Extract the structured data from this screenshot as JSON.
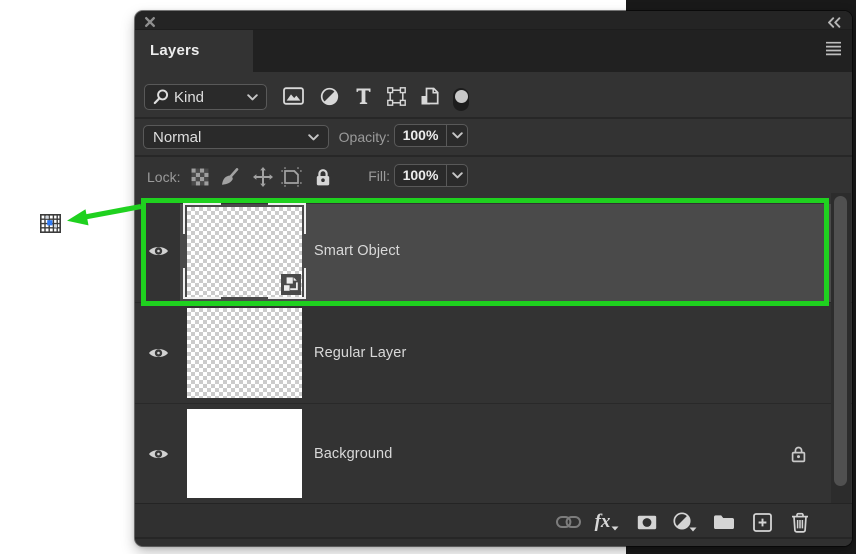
{
  "window": {
    "close_icon": "close",
    "collapse_icon": "collapse-double-chevron",
    "panel_menu_icon": "panel-menu"
  },
  "panel": {
    "tab": "Layers",
    "filter": {
      "kind_label": "Kind",
      "search_icon": "search",
      "type_icons": [
        "pixel-layer-filter",
        "adjustment-layer-filter",
        "type-layer-filter",
        "shape-layer-filter",
        "smart-object-filter"
      ],
      "filtering_toggle": "on"
    },
    "blend": {
      "mode": "Normal",
      "opacity_label": "Opacity:",
      "opacity_value": "100%"
    },
    "lock": {
      "label": "Lock:",
      "icons": [
        "lock-transparent-pixels",
        "lock-image-pixels",
        "lock-position",
        "lock-artboard-nesting",
        "lock-all"
      ],
      "fill_label": "Fill:",
      "fill_value": "100%"
    },
    "layers": [
      {
        "name": "Smart Object",
        "selected": true,
        "visible": true,
        "thumbnail": "transparent-checkerboard",
        "badge": "smart-object-badge"
      },
      {
        "name": "Regular Layer",
        "selected": false,
        "visible": true,
        "thumbnail": "transparent-checkerboard"
      },
      {
        "name": "Background",
        "selected": false,
        "visible": true,
        "thumbnail": "white",
        "locked": true
      }
    ],
    "toolbar": {
      "fx_label": "fx",
      "icons": [
        "link-layers",
        "layer-styles",
        "add-layer-mask",
        "new-adjustment-layer",
        "new-group",
        "new-layer",
        "delete-layer"
      ]
    }
  },
  "annotations": {
    "highlight_color": "#1fd11f",
    "pixel_icon_blue": "#2b74f1",
    "note": "green arrow from selected Smart Object layer to tiny canvas object"
  }
}
